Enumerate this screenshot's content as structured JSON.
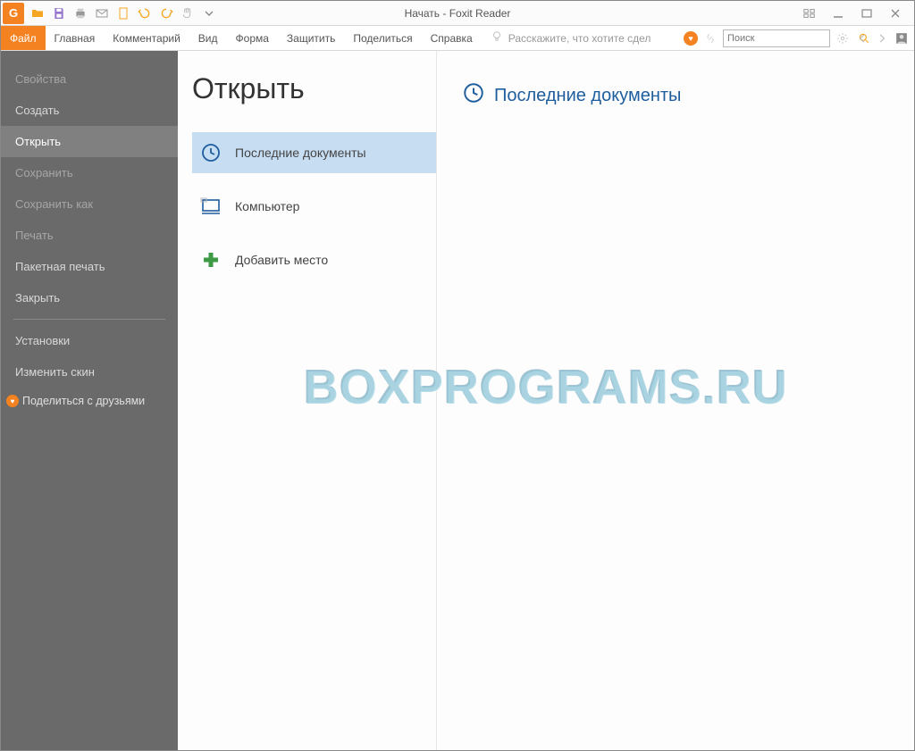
{
  "title": "Начать - Foxit Reader",
  "ribbon": {
    "file": "Файл",
    "home": "Главная",
    "comment": "Комментарий",
    "view": "Вид",
    "form": "Форма",
    "protect": "Защитить",
    "share": "Поделиться",
    "help": "Справка",
    "tellme_placeholder": "Расскажите, что хотите сдел"
  },
  "search": {
    "placeholder": "Поиск"
  },
  "sidebar": {
    "properties": "Свойства",
    "create": "Создать",
    "open": "Открыть",
    "save": "Сохранить",
    "saveas": "Сохранить как",
    "print": "Печать",
    "batchprint": "Пакетная печать",
    "close": "Закрыть",
    "settings": "Установки",
    "skin": "Изменить скин",
    "sharefriends": "Поделиться с друзьями"
  },
  "main": {
    "heading": "Открыть",
    "recent": "Последние документы",
    "computer": "Компьютер",
    "addplace": "Добавить место",
    "recent_heading": "Последние документы"
  },
  "watermark": "BOXPROGRAMS.RU"
}
